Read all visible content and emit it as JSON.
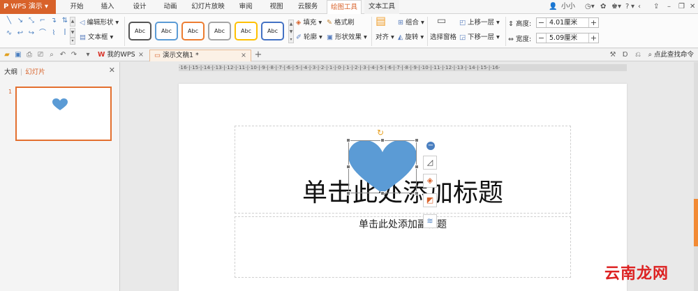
{
  "app": {
    "name": "WPS 演示",
    "logo_glyph": "P",
    "accent": "#d8622a"
  },
  "menu": {
    "tabs": [
      {
        "label": "开始"
      },
      {
        "label": "插入"
      },
      {
        "label": "设计"
      },
      {
        "label": "动画"
      },
      {
        "label": "幻灯片放映"
      },
      {
        "label": "审阅"
      },
      {
        "label": "视图"
      },
      {
        "label": "云服务"
      },
      {
        "label": "绘图工具"
      },
      {
        "label": "文本工具"
      }
    ],
    "active_tab": "绘图工具",
    "user": "小小",
    "help": "?"
  },
  "ribbon": {
    "edit_shape": "编辑形状",
    "textbox": "文本框",
    "style_label": "Abc",
    "fill": "填充",
    "format_brush": "格式刷",
    "outline": "轮廓",
    "shape_effects": "形状效果",
    "align": "对齐",
    "group": "组合",
    "rotate": "旋转",
    "selection_pane": "选择窗格",
    "bring_forward": "上移一层",
    "send_backward": "下移一层",
    "height_label": "高度:",
    "height_value": "4.01厘米",
    "width_label": "宽度:",
    "width_value": "5.09厘米"
  },
  "tabs": {
    "my_wps": "我的WPS",
    "doc": "演示文稿1 *",
    "search_cmd": "点此查找命令"
  },
  "left_panel": {
    "outline": "大纲",
    "slides": "幻灯片",
    "slide_number": "1"
  },
  "ruler_text": "·16·|·15·|·14·|·13·|·12·|·11·|·10·|·9·|·8·|·7·|·6·|·5·|·4·|·3·|·2·|·1·|·0·|·1·|·2·|·3·|·4·|·5·|·6·|·7·|·8·|·9·|·10·|·11·|·12·|·13·|·14·|·15·|·16·",
  "slide": {
    "title_placeholder": "单击此处添加标题",
    "subtitle_placeholder": "单击此处添加副标题",
    "heart_color": "#5b9bd5"
  },
  "watermark": "云南龙网"
}
